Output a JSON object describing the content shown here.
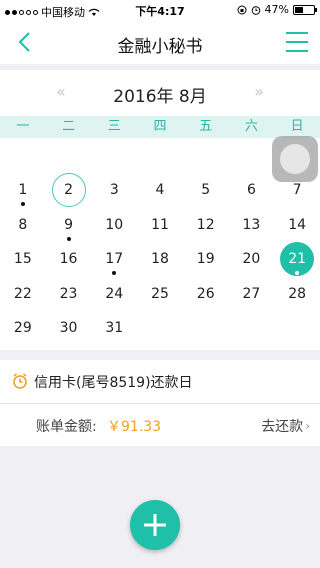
{
  "status_bar": {
    "carrier": "中国移动",
    "time": "下午4:17",
    "battery": "47%",
    "battery_level": 0.47,
    "signal_bars": 2
  },
  "nav": {
    "title": "金融小秘书",
    "back_icon": "chevron-left-icon",
    "menu_icon": "menu-icon"
  },
  "calendar": {
    "month_title": "2016年 8月",
    "prev": "«",
    "next": "»",
    "weekdays": [
      "一",
      "二",
      "三",
      "四",
      "五",
      "六",
      "日"
    ],
    "weeks": [
      [
        "1",
        "2",
        "3",
        "4",
        "5",
        "6",
        "7"
      ],
      [
        "8",
        "9",
        "10",
        "11",
        "12",
        "13",
        "14"
      ],
      [
        "15",
        "16",
        "17",
        "18",
        "19",
        "20",
        "21"
      ],
      [
        "22",
        "23",
        "24",
        "25",
        "26",
        "27",
        "28"
      ],
      [
        "29",
        "30",
        "31",
        "",
        "",
        "",
        ""
      ]
    ],
    "today": "2",
    "selected": "21",
    "marked_days": [
      "1",
      "9",
      "17",
      "21"
    ]
  },
  "reminder": {
    "title": "信用卡(尾号8519)还款日",
    "amount_label": "账单金额:",
    "amount_value": "￥91.33",
    "action": "去还款",
    "action_chevron": "›"
  },
  "fab": {
    "label": "+",
    "icon": "plus-icon"
  },
  "colors": {
    "accent": "#1fbfa8",
    "amount": "#f0a020",
    "weekday_bg": "#dff3f0"
  }
}
